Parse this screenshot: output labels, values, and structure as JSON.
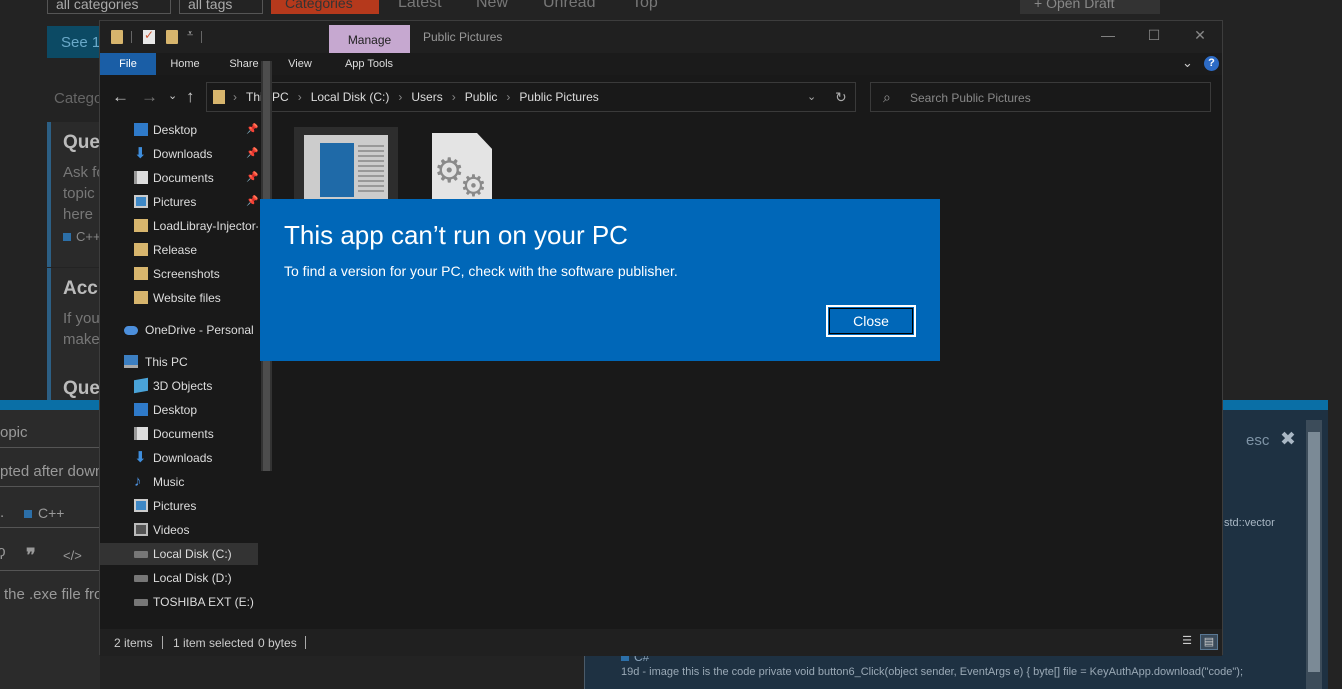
{
  "background_page": {
    "filters": [
      "all categories",
      "all tags"
    ],
    "nav": {
      "categories": "Categories",
      "latest": "Latest",
      "new": "New",
      "unread": "Unread",
      "top": "Top",
      "open_draft": "+ Open Draft"
    },
    "see_button": "See 1",
    "categories_label": "Catego",
    "cards": [
      {
        "title": "Que",
        "text": "Ask fo topic here",
        "tag": "C++"
      },
      {
        "title": "Acc",
        "text": "If you make"
      },
      {
        "title": "Que"
      }
    ],
    "composer": {
      "topic_placeholder": "opic",
      "title_value": "pted after downl",
      "category": "C++",
      "body_text": "the .exe file fro",
      "toolbar_icons": [
        "link-icon",
        "quote-icon",
        "code-icon"
      ]
    },
    "preview": {
      "esc_label": "esc",
      "snippet": "std::vector",
      "bottom_lang": "C#",
      "bottom_text": "19d - image this is the code private void button6_Click(object sender, EventArgs e) { byte[] file = KeyAuthApp.download(\"code\");"
    }
  },
  "explorer": {
    "title": "Public Pictures",
    "manage_tab": "Manage",
    "ribbon_tabs": [
      "File",
      "Home",
      "Share",
      "View",
      "App Tools"
    ],
    "breadcrumbs": [
      "This PC",
      "Local Disk (C:)",
      "Users",
      "Public",
      "Public Pictures"
    ],
    "search_placeholder": "Search Public Pictures",
    "nav_items": [
      {
        "label": "Desktop",
        "icon": "desktop-icon",
        "pinned": true
      },
      {
        "label": "Downloads",
        "icon": "downloads-icon",
        "pinned": true
      },
      {
        "label": "Documents",
        "icon": "documents-icon",
        "pinned": true
      },
      {
        "label": "Pictures",
        "icon": "pictures-icon",
        "pinned": true
      },
      {
        "label": "LoadLibray-Injector-",
        "icon": "folder-icon"
      },
      {
        "label": "Release",
        "icon": "folder-icon"
      },
      {
        "label": "Screenshots",
        "icon": "folder-icon"
      },
      {
        "label": "Website files",
        "icon": "folder-icon"
      },
      {
        "label": "OneDrive - Personal",
        "icon": "onedrive-icon"
      },
      {
        "label": "This PC",
        "icon": "this-pc-icon"
      },
      {
        "label": "3D Objects",
        "icon": "3d-objects-icon"
      },
      {
        "label": "Desktop",
        "icon": "desktop-icon"
      },
      {
        "label": "Documents",
        "icon": "documents-icon"
      },
      {
        "label": "Downloads",
        "icon": "downloads-icon"
      },
      {
        "label": "Music",
        "icon": "music-icon"
      },
      {
        "label": "Pictures",
        "icon": "pictures-icon"
      },
      {
        "label": "Videos",
        "icon": "videos-icon"
      },
      {
        "label": "Local Disk (C:)",
        "icon": "drive-icon",
        "selected": true
      },
      {
        "label": "Local Disk (D:)",
        "icon": "drive-icon"
      },
      {
        "label": "TOSHIBA EXT (E:)",
        "icon": "drive-icon"
      }
    ],
    "status": {
      "items": "2 items",
      "selected": "1 item selected",
      "size": "0 bytes"
    }
  },
  "dialog": {
    "title": "This app can’t run on your PC",
    "message": "To find a version for your PC, check with the software publisher.",
    "close_label": "Close"
  },
  "colors": {
    "dialog_bg": "#0067b8",
    "file_tab": "#1a5ea6",
    "manage_tab": "#c6a8d0",
    "accent": "#0a6fa6"
  }
}
